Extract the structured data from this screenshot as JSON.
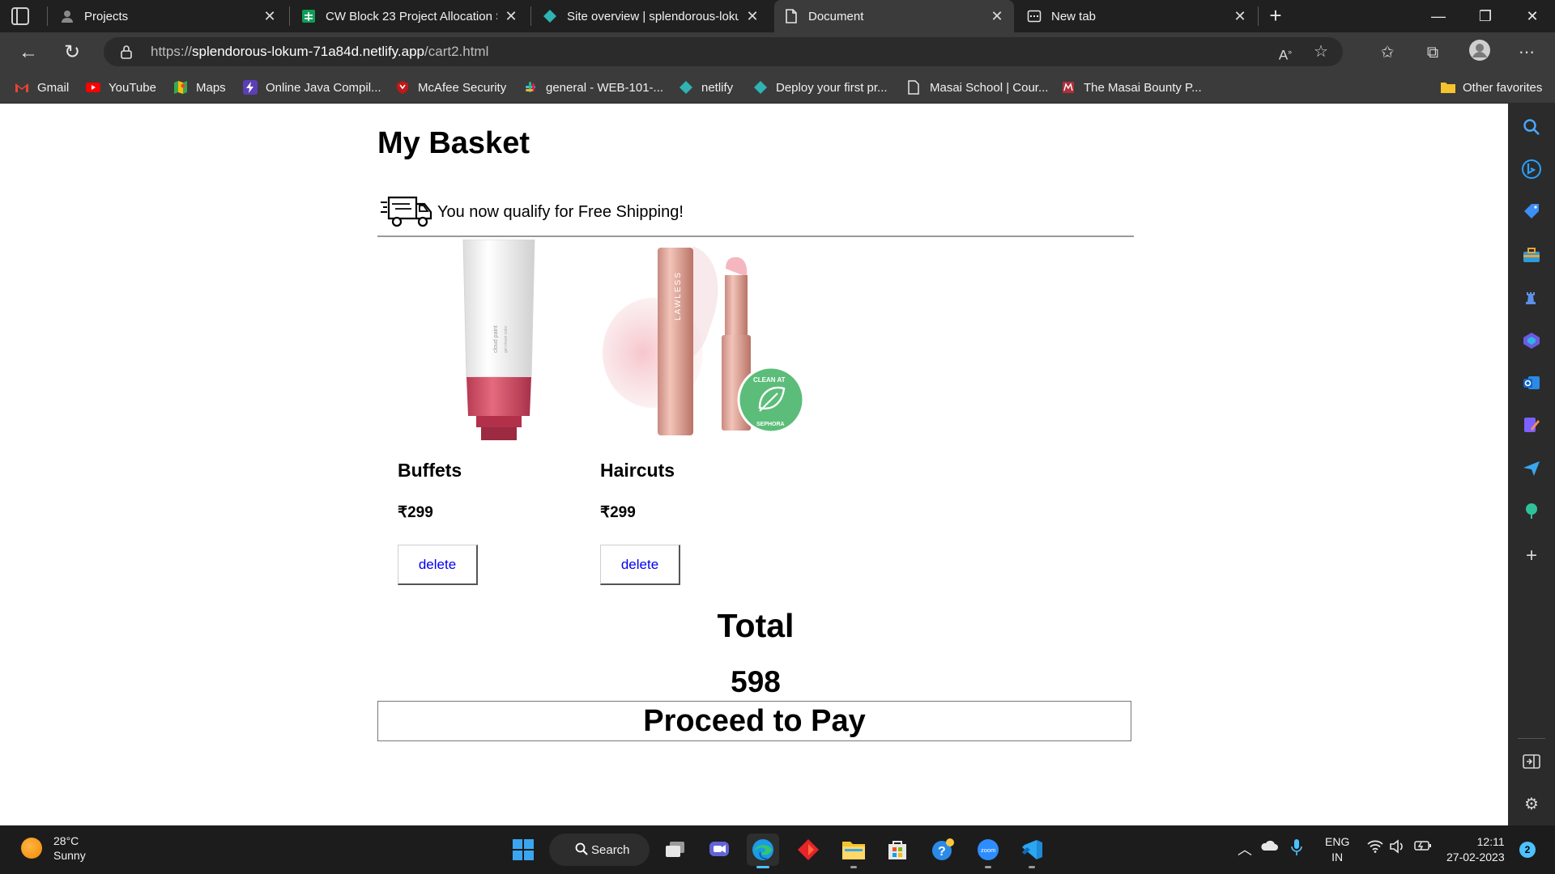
{
  "browser": {
    "tabs": [
      {
        "label": "Projects",
        "icon": "user-avatar-icon"
      },
      {
        "label": "CW Block 23 Project Allocation S",
        "icon": "google-sheets-icon"
      },
      {
        "label": "Site overview | splendorous-loku",
        "icon": "netlify-icon"
      },
      {
        "label": "Document",
        "icon": "document-icon",
        "active": true
      },
      {
        "label": "New tab",
        "icon": "newtab-icon"
      }
    ],
    "url_prefix": "https://",
    "url_host": "splendorous-lokum-71a84d.netlify.app",
    "url_path": "/cart2.html",
    "bookmarks": [
      {
        "label": "Gmail",
        "icon": "gmail-icon"
      },
      {
        "label": "YouTube",
        "icon": "youtube-icon"
      },
      {
        "label": "Maps",
        "icon": "maps-icon"
      },
      {
        "label": "Online Java Compil...",
        "icon": "lightning-icon"
      },
      {
        "label": "McAfee Security",
        "icon": "mcafee-icon"
      },
      {
        "label": "general - WEB-101-...",
        "icon": "slack-icon"
      },
      {
        "label": "netlify",
        "icon": "netlify-icon"
      },
      {
        "label": "Deploy your first pr...",
        "icon": "netlify-icon"
      },
      {
        "label": "Masai School | Cour...",
        "icon": "document-icon"
      },
      {
        "label": "The Masai Bounty P...",
        "icon": "masai-icon"
      }
    ],
    "other_favorites": "Other favorites"
  },
  "page": {
    "title": "My Basket",
    "shipping_message": "You now qualify for Free Shipping!",
    "products": [
      {
        "name": "Buffets",
        "price": "₹299",
        "delete_label": "delete",
        "image": "blush-tube-image"
      },
      {
        "name": "Haircuts",
        "price": "₹299",
        "delete_label": "delete",
        "image": "lip-balm-image"
      }
    ],
    "total_label": "Total",
    "total_value": "598",
    "pay_label": "Proceed to Pay"
  },
  "taskbar": {
    "weather_temp": "28°C",
    "weather_desc": "Sunny",
    "search_label": "Search",
    "lang_line1": "ENG",
    "lang_line2": "IN",
    "time": "12:11",
    "date": "27-02-2023",
    "notification_count": "2"
  }
}
